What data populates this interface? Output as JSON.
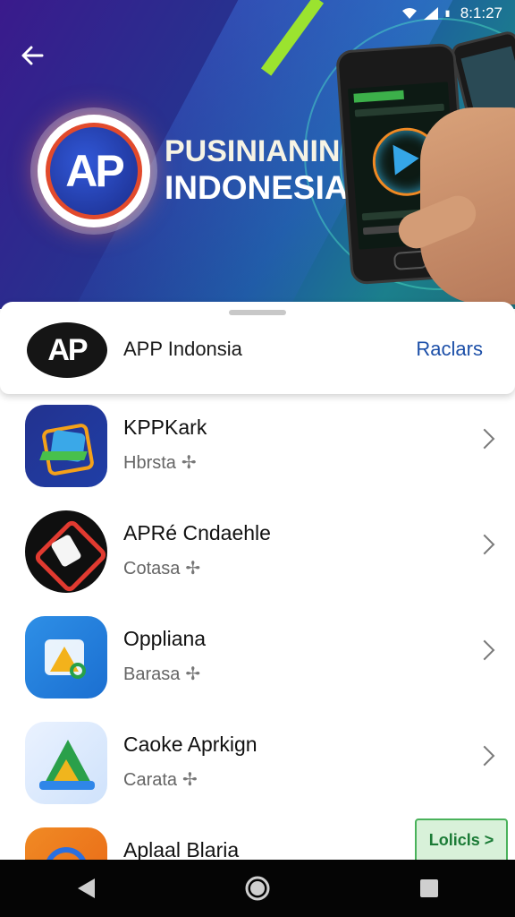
{
  "status_bar": {
    "time": "8:1:27",
    "icons": [
      "wifi-icon",
      "signal-icon",
      "battery-icon"
    ]
  },
  "hero": {
    "logo_text": "AP",
    "title_line1": "PUSINIANIN",
    "title_line2": "INDONESIA"
  },
  "sheet": {
    "logo_text": "AP",
    "title": "APP Indonsia",
    "action_label": "Raclars"
  },
  "apps": [
    {
      "name": "KPPKark",
      "sub": "Hbrsta",
      "icon": "app-icon-1"
    },
    {
      "name": "APRé Cndaehle",
      "sub": "Cotasa",
      "icon": "app-icon-2"
    },
    {
      "name": "Oppliana",
      "sub": "Barasa",
      "icon": "app-icon-3"
    },
    {
      "name": "Caoke Aprkign",
      "sub": "Carata",
      "icon": "app-icon-4"
    },
    {
      "name": "Aplaal Blaria",
      "sub": "",
      "icon": "app-icon-5"
    }
  ],
  "promo_badge": "Lolicls > Plnga",
  "colors": {
    "accent": "#1c4fa8",
    "hero_start": "#3a1a8c",
    "hero_end": "#1c6d7a"
  }
}
